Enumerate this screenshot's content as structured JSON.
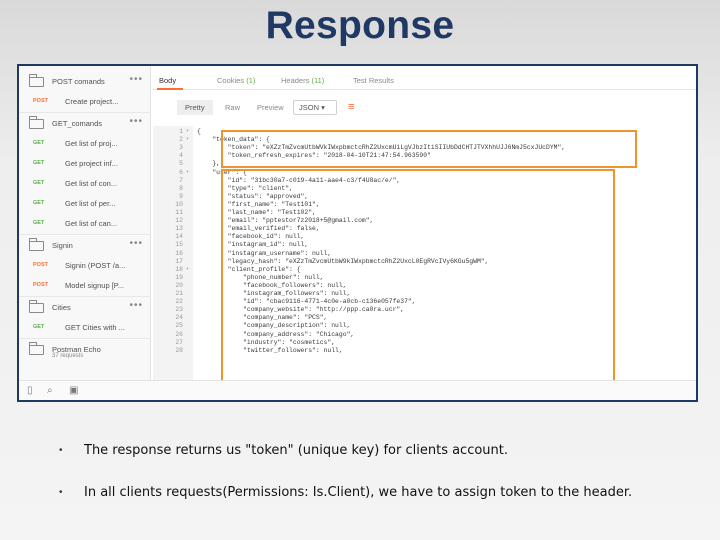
{
  "title": "Response",
  "sidebar": {
    "folders": [
      {
        "label": "POST comands",
        "dots": "•••"
      },
      {
        "label": "GET_comands",
        "dots": "•••"
      },
      {
        "label": "Signin",
        "dots": "•••"
      },
      {
        "label": "Cities",
        "dots": "•••"
      }
    ],
    "requests": [
      {
        "method": "POST",
        "label": "Create project..."
      },
      {
        "method": "GET",
        "label": "Get list of proj..."
      },
      {
        "method": "GET",
        "label": "Get project inf..."
      },
      {
        "method": "GET",
        "label": "Get list of con..."
      },
      {
        "method": "GET",
        "label": "Get list of per..."
      },
      {
        "method": "GET",
        "label": "Get list of can..."
      },
      {
        "method": "POST",
        "label": "Signin (POST /a..."
      },
      {
        "method": "POST",
        "label": "Model signup [P..."
      },
      {
        "method": "GET",
        "label": "GET Cities with ..."
      }
    ],
    "collection": {
      "name": "Postman Echo",
      "sub": "37 requests"
    }
  },
  "tabs": {
    "body": "Body",
    "cookies": "Cookies",
    "cookies_count": "(1)",
    "headers": "Headers",
    "headers_count": "(11)",
    "test_results": "Test Results"
  },
  "toolbar": {
    "pretty": "Pretty",
    "raw": "Raw",
    "preview": "Preview",
    "format": "JSON",
    "format_caret": "▾"
  },
  "code_lines": [
    {
      "n": "1",
      "fold": "▾",
      "t": "{"
    },
    {
      "n": "2",
      "fold": "▾",
      "t": "    \"token_data\": {"
    },
    {
      "n": "3",
      "fold": "",
      "t": "        \"token\": \"eXZzTmZvcmUtbWVkIWxpbmctcRhZ2UxcmUiLgVJbzItiSIIUbDdCHTJTVXhhUJJ6NmJ5cxJUcDYM\","
    },
    {
      "n": "4",
      "fold": "",
      "t": "        \"token_refresh_expires\": \"2018-04-10T21:47:54.963590\""
    },
    {
      "n": "5",
      "fold": "",
      "t": "    },"
    },
    {
      "n": "6",
      "fold": "▾",
      "t": "    \"user\": {"
    },
    {
      "n": "7",
      "fold": "",
      "t": "        \"id\": \"31bc30a7-c019-4a11-aae4-c3/f4U8ac/e/\","
    },
    {
      "n": "8",
      "fold": "",
      "t": "        \"type\": \"client\","
    },
    {
      "n": "9",
      "fold": "",
      "t": "        \"status\": \"approved\","
    },
    {
      "n": "10",
      "fold": "",
      "t": "        \"first_name\": \"Test101\","
    },
    {
      "n": "11",
      "fold": "",
      "t": "        \"last_name\": \"Test102\","
    },
    {
      "n": "12",
      "fold": "",
      "t": "        \"email\": \"pptestor7z2018+5@gmail.com\","
    },
    {
      "n": "13",
      "fold": "",
      "t": "        \"email_verified\": false,"
    },
    {
      "n": "14",
      "fold": "",
      "t": "        \"facebook_id\": null,"
    },
    {
      "n": "15",
      "fold": "",
      "t": "        \"instagram_id\": null,"
    },
    {
      "n": "16",
      "fold": "",
      "t": "        \"instagram_username\": null,"
    },
    {
      "n": "17",
      "fold": "",
      "t": "        \"legacy_hash\": \"eXZzTmZvcmUtbW9kIWxpbmctcRhZ2UxcL0EgRVcIVy6KGu5gWM\","
    },
    {
      "n": "18",
      "fold": "▾",
      "t": "        \"client_profile\": {"
    },
    {
      "n": "19",
      "fold": "",
      "t": "            \"phone_number\": null,"
    },
    {
      "n": "20",
      "fold": "",
      "t": "            \"facebook_followers\": null,"
    },
    {
      "n": "21",
      "fold": "",
      "t": "            \"instagram_followers\": null,"
    },
    {
      "n": "22",
      "fold": "",
      "t": "            \"id\": \"cbac9116-4771-4c0e-a0cb-c136e057fe37\","
    },
    {
      "n": "23",
      "fold": "",
      "t": "            \"company_website\": \"http://ppp.ca0ra.ucr\","
    },
    {
      "n": "24",
      "fold": "",
      "t": "            \"company_name\": \"PCS\","
    },
    {
      "n": "25",
      "fold": "",
      "t": "            \"company_description\": null,"
    },
    {
      "n": "26",
      "fold": "",
      "t": "            \"company_address\": \"Chicago\","
    },
    {
      "n": "27",
      "fold": "",
      "t": "            \"industry\": \"cosmetics\","
    },
    {
      "n": "28",
      "fold": "",
      "t": "            \"twitter_followers\": null,"
    }
  ],
  "bullets": [
    "The response returns us \"token\" (unique key) for clients account.",
    "In all clients requests(Permissions: Is.Client), we have to assign token to the header."
  ],
  "colors": {
    "title": "#1f3864",
    "highlight": "#f0932b",
    "post": "#ff6c37",
    "get": "#5cae4c"
  }
}
